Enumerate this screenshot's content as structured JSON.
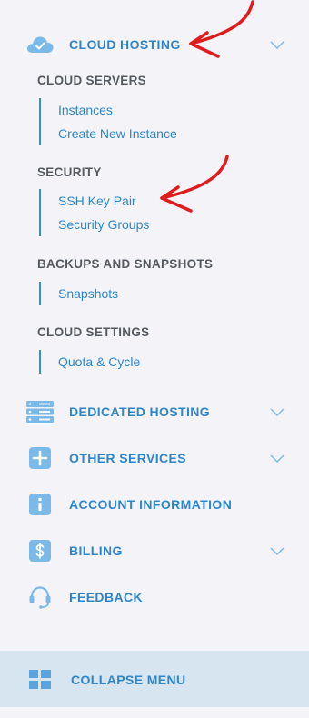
{
  "nav": {
    "cloud_hosting": {
      "label": "CLOUD HOSTING",
      "icon": "cloud-check-icon",
      "expanded": true
    },
    "dedicated_hosting": {
      "label": "DEDICATED HOSTING",
      "icon": "server-icon"
    },
    "other_services": {
      "label": "OTHER SERVICES",
      "icon": "plus-square-icon"
    },
    "account_information": {
      "label": "ACCOUNT INFORMATION",
      "icon": "info-icon"
    },
    "billing": {
      "label": "BILLING",
      "icon": "dollar-icon"
    },
    "feedback": {
      "label": "FEEDBACK",
      "icon": "headset-icon"
    }
  },
  "cloud_sections": [
    {
      "title": "CLOUD SERVERS",
      "links": [
        "Instances",
        "Create New Instance"
      ]
    },
    {
      "title": "SECURITY",
      "links": [
        "SSH Key Pair",
        "Security Groups"
      ]
    },
    {
      "title": "BACKUPS AND SNAPSHOTS",
      "links": [
        "Snapshots"
      ]
    },
    {
      "title": "CLOUD SETTINGS",
      "links": [
        "Quota & Cycle"
      ]
    }
  ],
  "collapse": {
    "label": "COLLAPSE MENU",
    "icon": "grid-icon"
  },
  "colors": {
    "accent": "#2e86c9",
    "icon_fill": "#7ab9e8",
    "section_title": "#555a61",
    "background": "#f4f3f8",
    "collapse_bg": "#d7e5f0",
    "annotation": "#e01b1b"
  }
}
